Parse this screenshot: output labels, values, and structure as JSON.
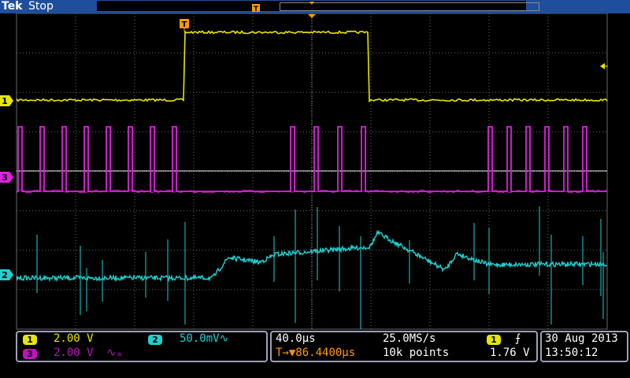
{
  "header": {
    "brand": "Tek",
    "status": "Stop"
  },
  "markers": {
    "trigger": "T",
    "ch1": "1",
    "ch2": "2",
    "ch3": "3"
  },
  "colors": {
    "ch1": "#e6e600",
    "ch2": "#1fd0d0",
    "ch3": "#e020e0",
    "trigger": "#ff9a00",
    "grid": "#6a6a6a"
  },
  "channels": {
    "ch1": {
      "label": "1",
      "scale": "2.00 V"
    },
    "ch2": {
      "label": "2",
      "scale": "50.0mV",
      "coupling_symbol": "∿"
    },
    "ch3": {
      "label": "3",
      "scale": "2.00 V",
      "coupling_symbol": "∿ₐ"
    }
  },
  "horizontal": {
    "timebase": "40.0µs",
    "sample_rate": "25.0MS/s",
    "record_length": "10k points",
    "trigger_offset": "86.4400µs",
    "offset_symbol": "T→▼"
  },
  "trigger": {
    "source": "1",
    "slope_icon": "rising-edge-icon",
    "slope_symbol": "⨍",
    "level": "1.76 V"
  },
  "datetime": {
    "date": "30 Aug 2013",
    "time": "13:50:12"
  }
}
